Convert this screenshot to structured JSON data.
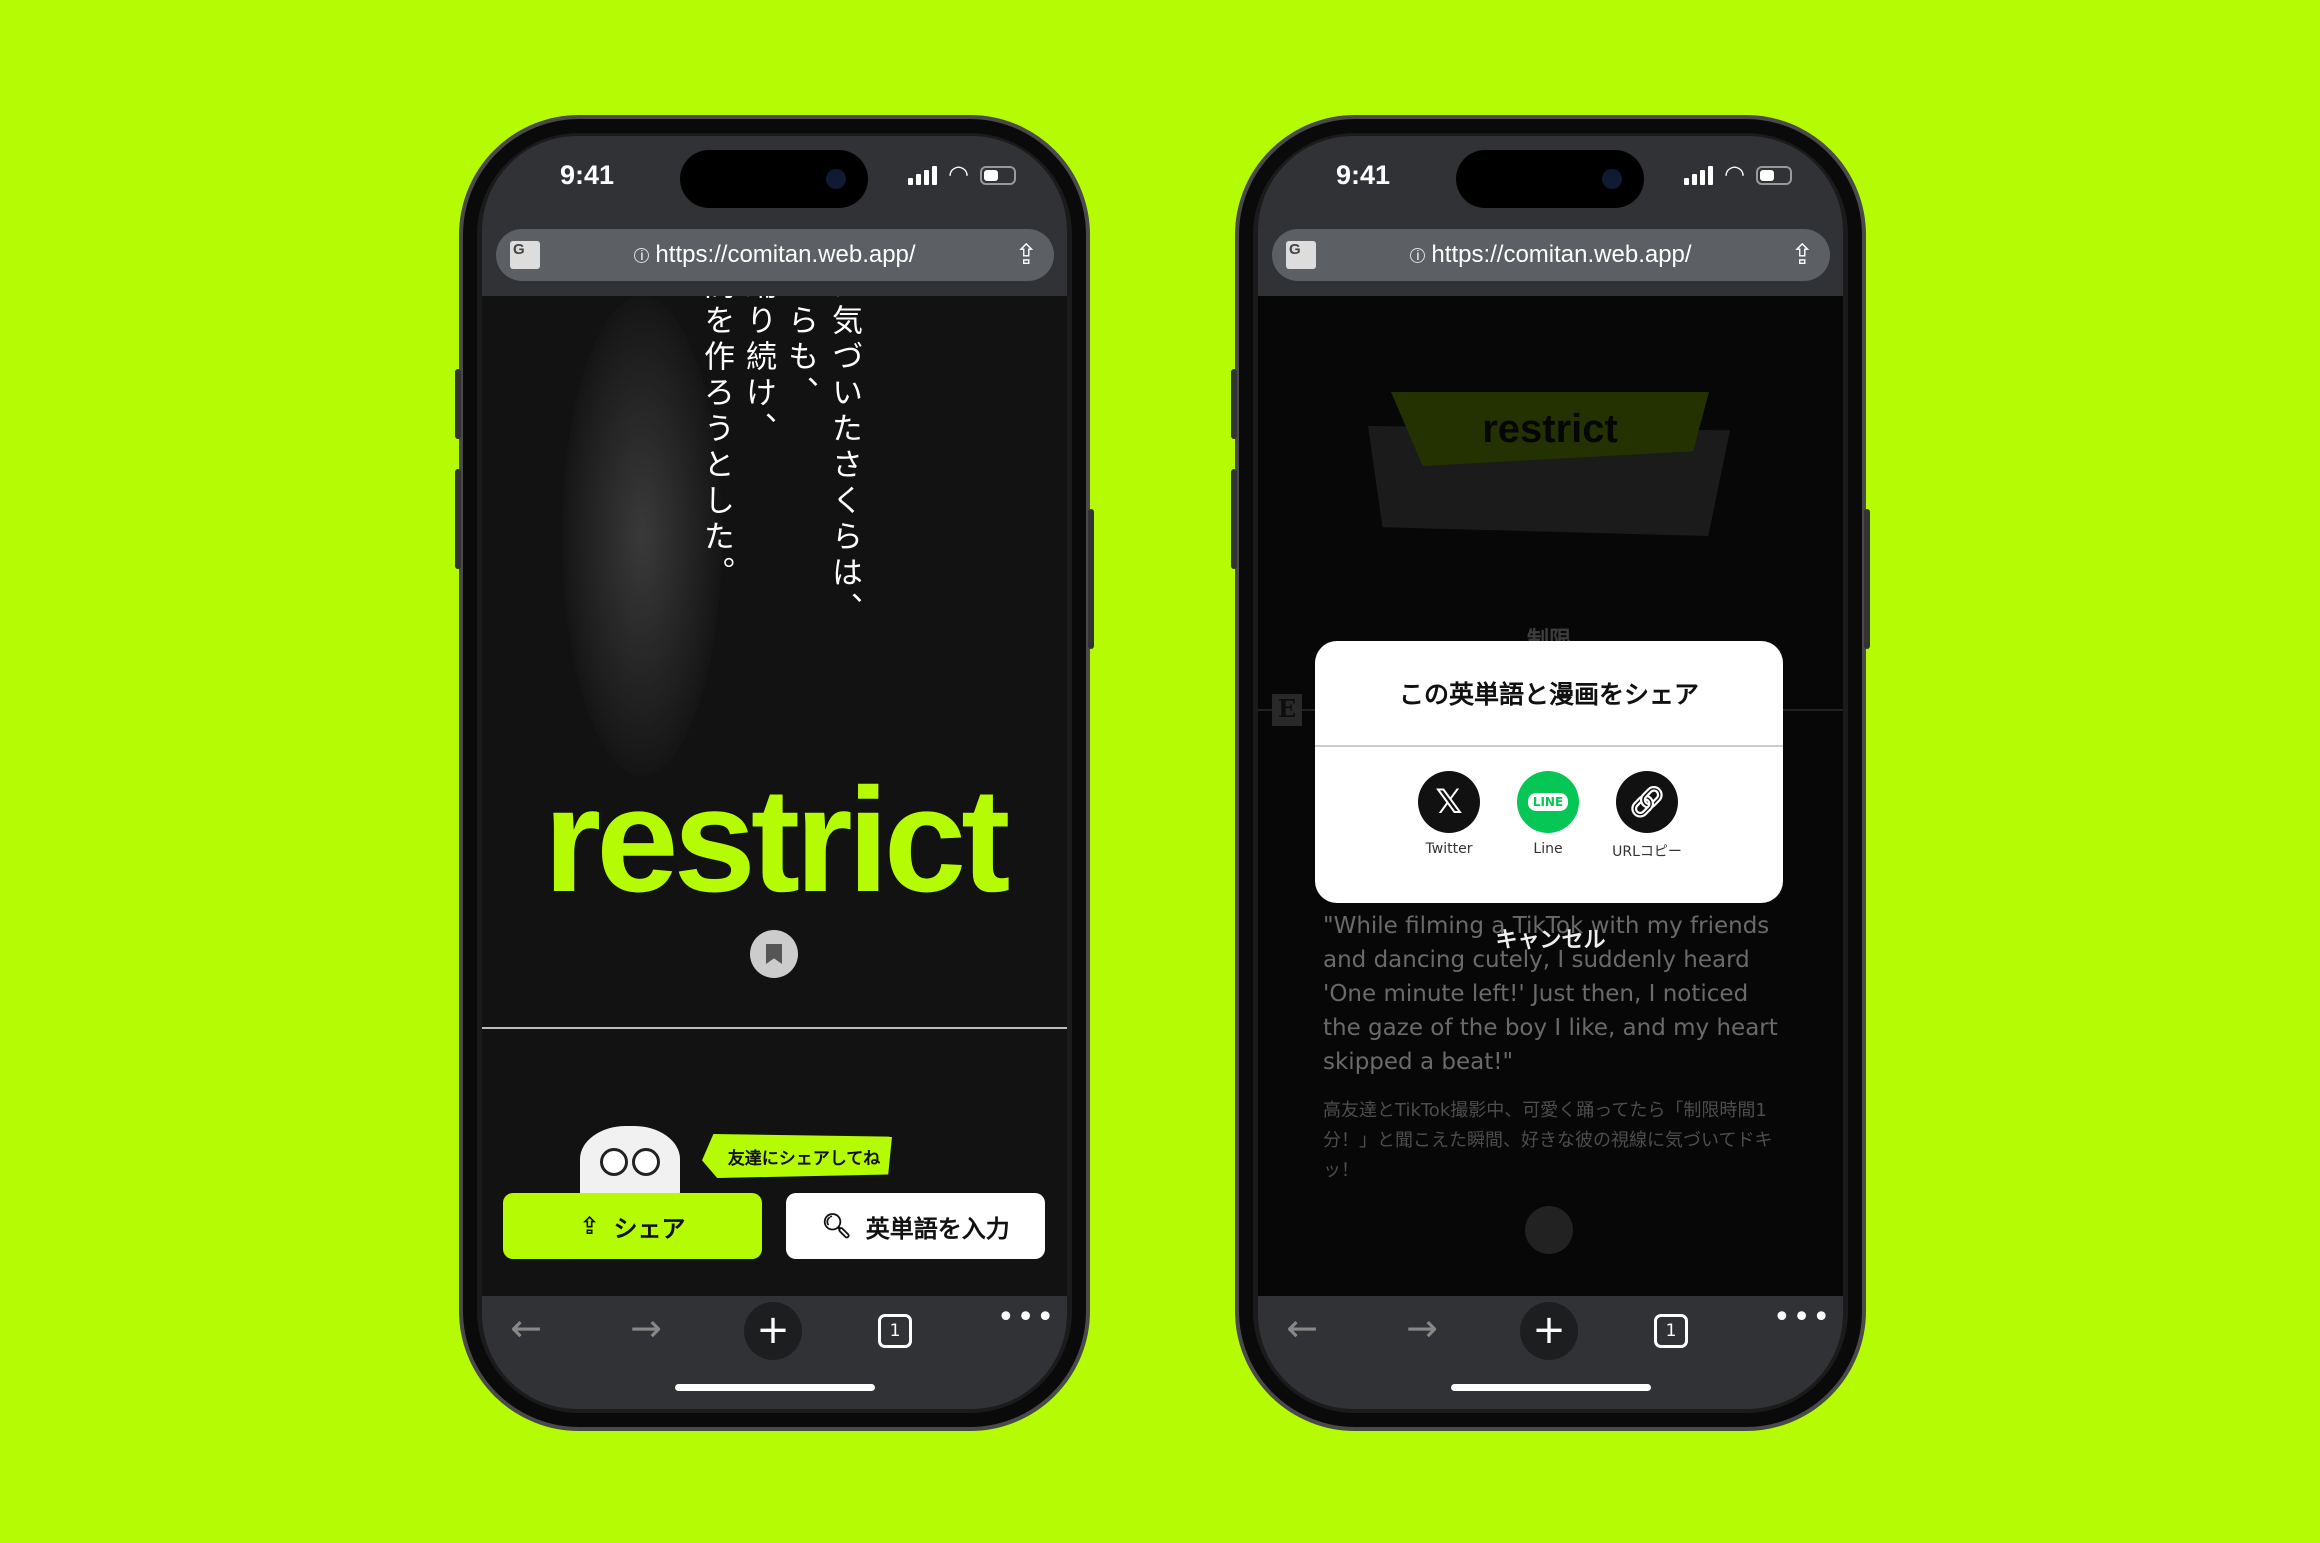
{
  "accent": "#b5fb03",
  "status": {
    "time": "9:41"
  },
  "browser": {
    "url": "https://comitan.web.app/",
    "tab_count": "1",
    "translate_label": "G"
  },
  "phone1": {
    "vertical_text": [
      "に気づいたさくらは、",
      "からも、",
      "踊り続け、",
      "間を作ろうとした。"
    ],
    "word": "restrict",
    "bubble": "友達にシェアしてね",
    "share_button": "シェア",
    "search_button": "英単語を入力"
  },
  "phone2": {
    "word": "restrict",
    "meaning": "制限",
    "badge": "E",
    "example_en": "\"While filming a TikTok with my friends and dancing cutely, I suddenly heard 'One minute left!' Just then, I noticed the gaze of the boy I like, and my heart skipped a beat!\"",
    "example_ja": "高友達とTikTok撮影中、可愛く踊ってたら「制限時間1分！」と聞こえた瞬間、好きな彼の視線に気づいてドキッ！",
    "modal": {
      "title": "この英単語と漫画をシェア",
      "options": [
        {
          "label": "Twitter",
          "icon": "x-logo-icon",
          "color": "#111111"
        },
        {
          "label": "Line",
          "icon": "line-logo-icon",
          "color": "#06c755",
          "badge": "LINE"
        },
        {
          "label": "URLコピー",
          "icon": "link-icon",
          "color": "#111111"
        }
      ],
      "cancel": "キャンセル"
    }
  }
}
